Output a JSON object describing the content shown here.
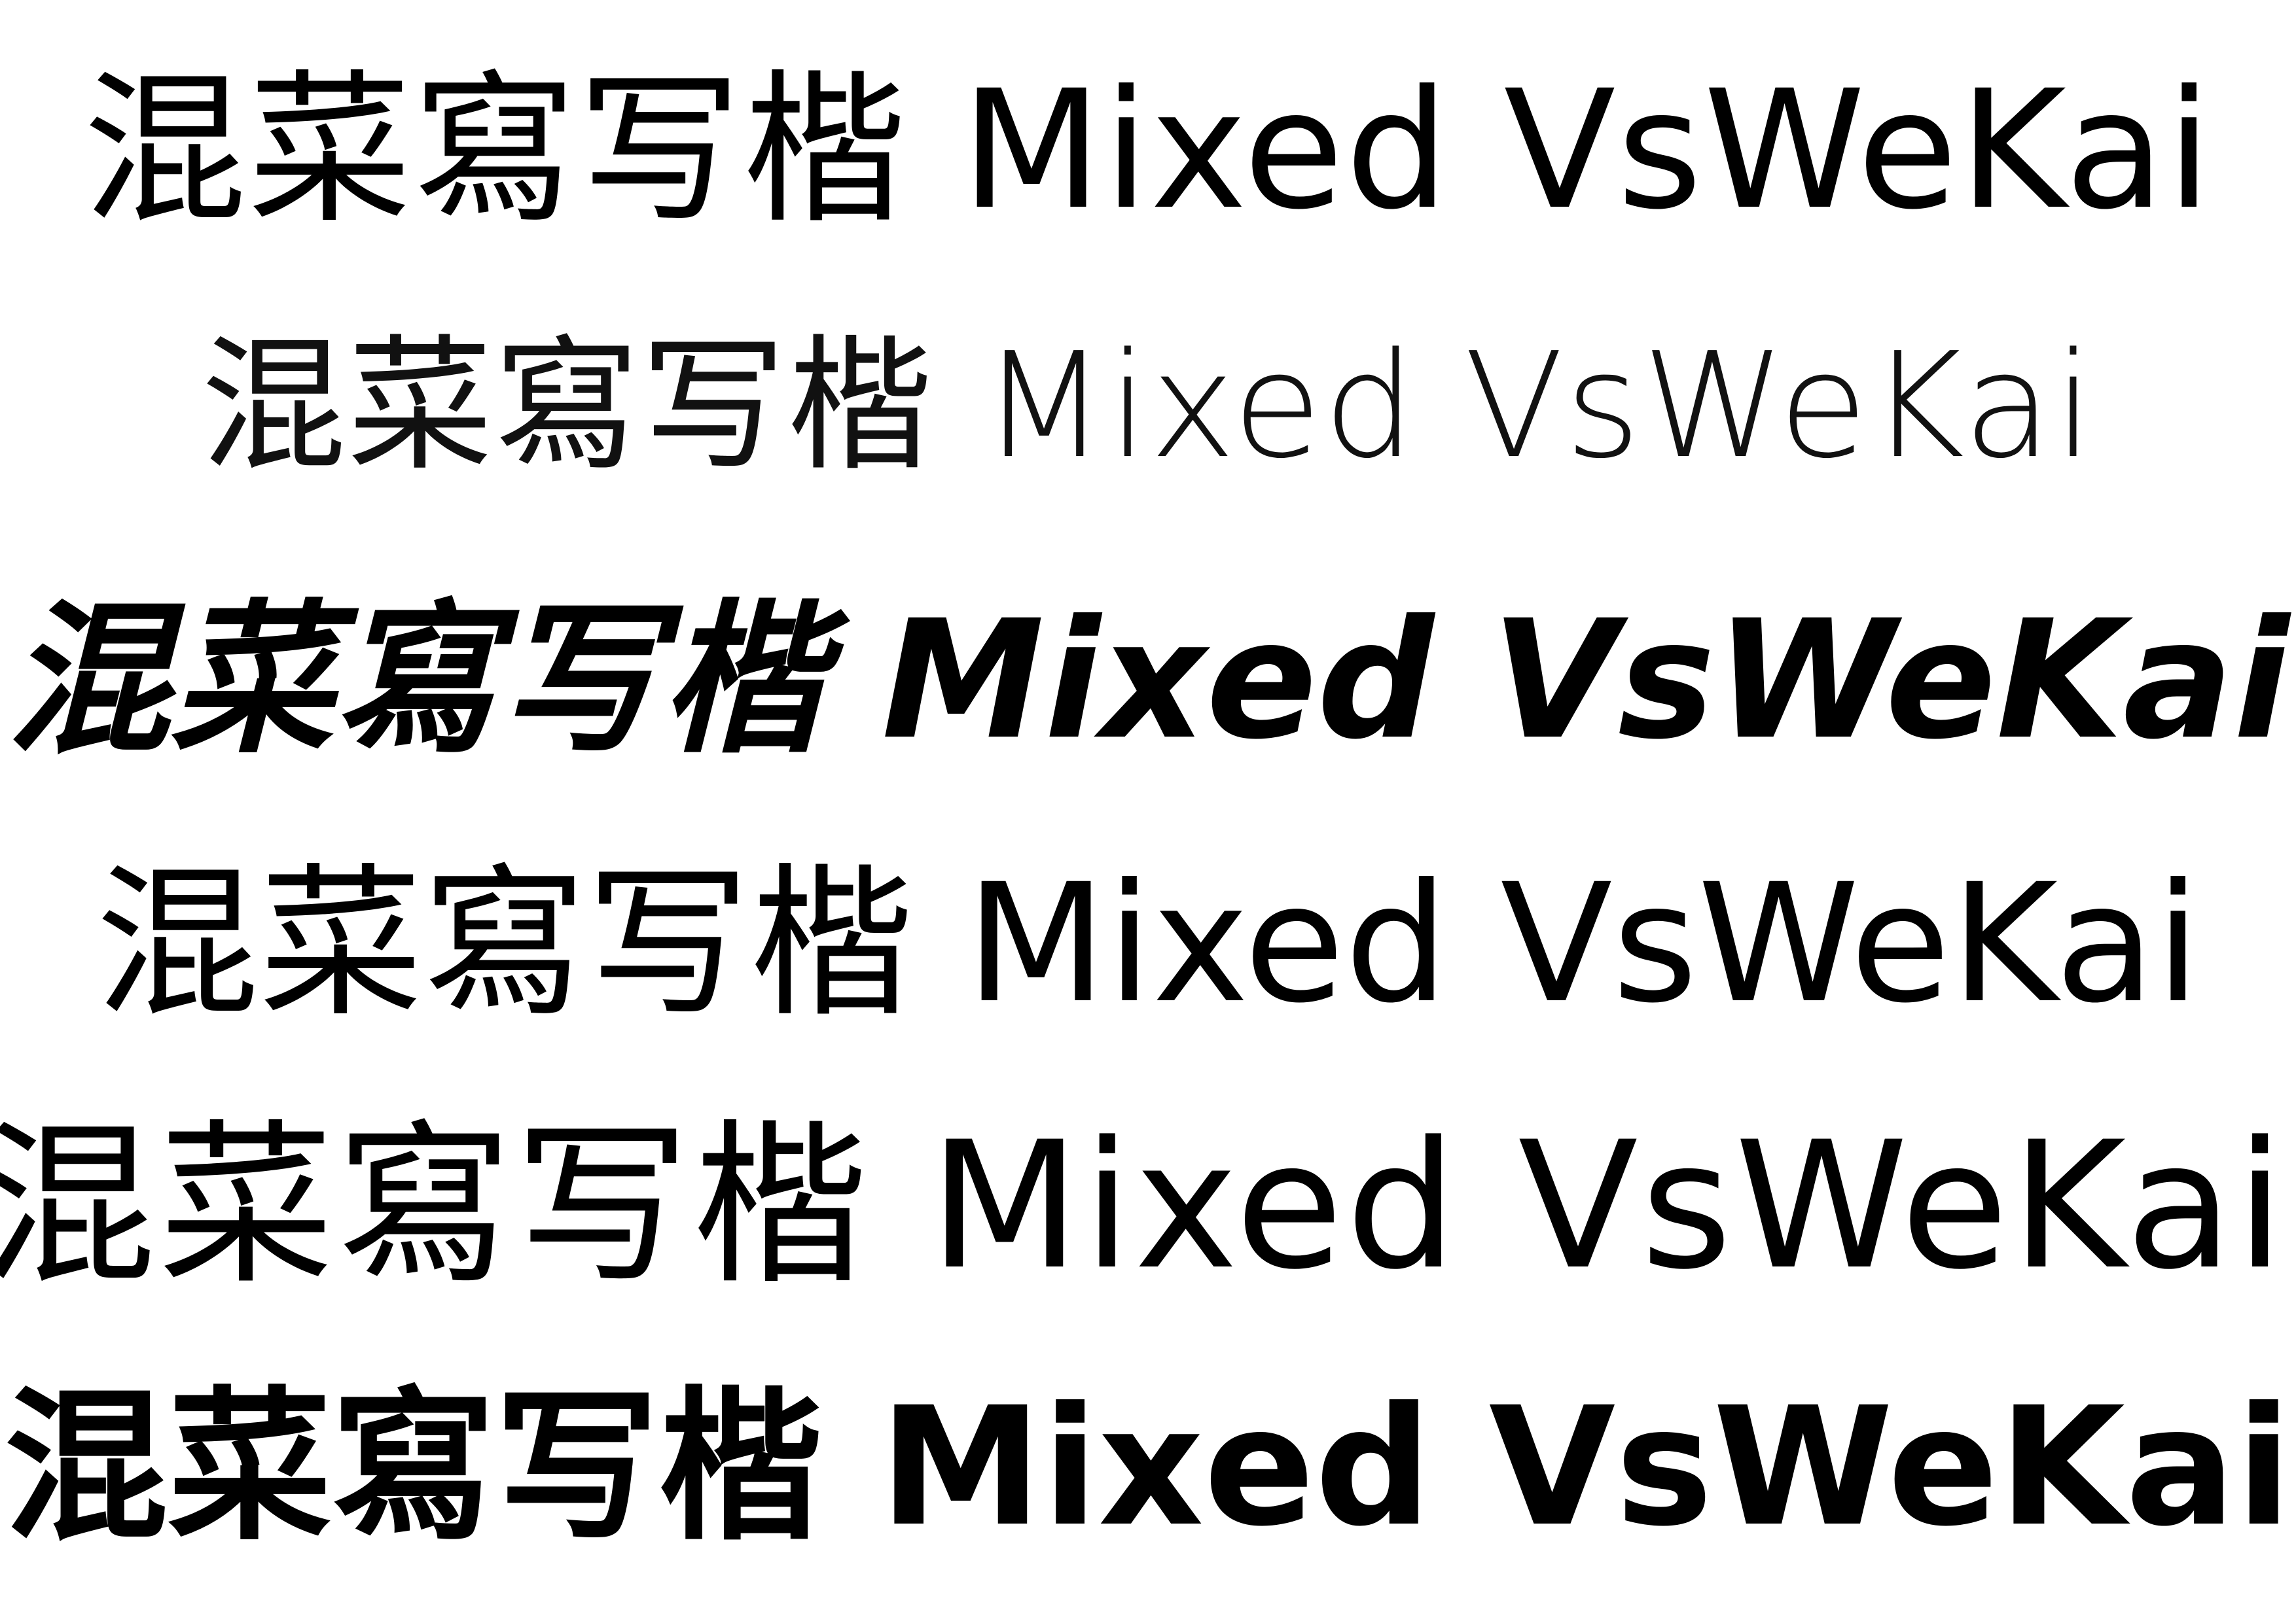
{
  "samples": [
    {
      "text": "混菜寫写楷 Mixed VsWeKai",
      "style": "regular"
    },
    {
      "text": "混菜寫写楷 Mixed VsWeKai",
      "style": "light"
    },
    {
      "text": "混菜寫写楷 Mixed VsWeKai",
      "style": "bold-italic"
    },
    {
      "text": "混菜寫写楷 Mixed VsWeKai",
      "style": "medium"
    },
    {
      "text": "混菜寫写楷 Mixed VsWeKai",
      "style": "wide"
    },
    {
      "text": "混菜寫写楷 Mixed VsWeKai",
      "style": "bold"
    }
  ],
  "colors": {
    "background": "#ffffff",
    "text": "#000000"
  }
}
